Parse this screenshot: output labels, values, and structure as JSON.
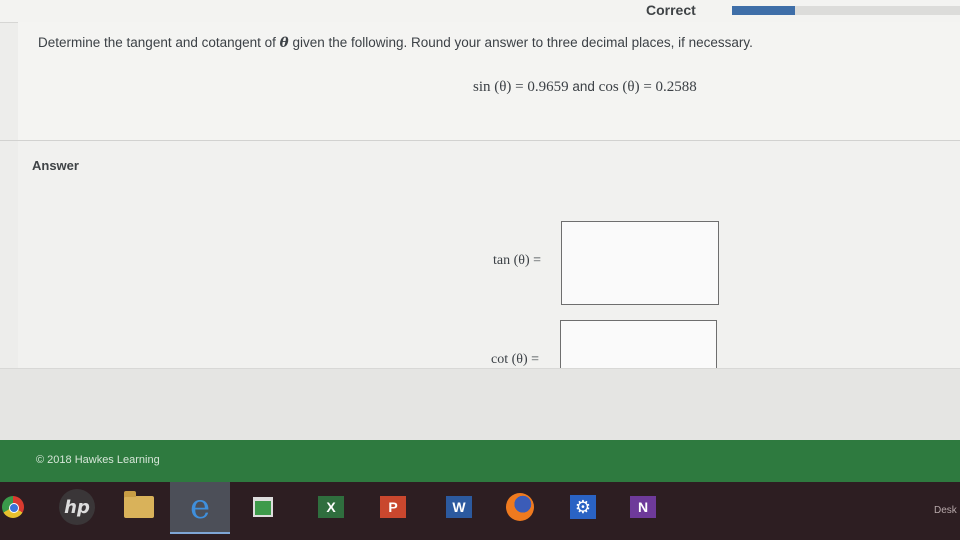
{
  "header": {
    "status_label": "Correct",
    "progress_fraction": 0.28
  },
  "question": {
    "prompt_before": "Determine the tangent and cotangent of ",
    "theta_symbol": "θ",
    "prompt_after": " given the following. Round your answer to three decimal places, if necessary.",
    "given_sin": "sin (θ) = 0.9659",
    "given_and": " and ",
    "given_cos": "cos (θ) = 0.2588"
  },
  "answer": {
    "heading": "Answer",
    "tan_label": "tan (θ) =",
    "tan_value": "",
    "cot_label": "cot (θ) =",
    "cot_value": ""
  },
  "footer": {
    "copyright": "© 2018 Hawkes Learning"
  },
  "taskbar": {
    "icons": [
      "chrome-icon",
      "hp-icon",
      "file-explorer-icon",
      "internet-explorer-icon",
      "store-icon",
      "excel-icon",
      "powerpoint-icon",
      "word-icon",
      "firefox-icon",
      "settings-gear-icon",
      "onenote-icon"
    ],
    "hp_text": "hp",
    "ie_glyph": "e",
    "excel_text": "X",
    "powerpoint_text": "P",
    "word_text": "W",
    "gear_glyph": "⚙",
    "onenote_text": "N",
    "desktop_label": "Desk"
  }
}
